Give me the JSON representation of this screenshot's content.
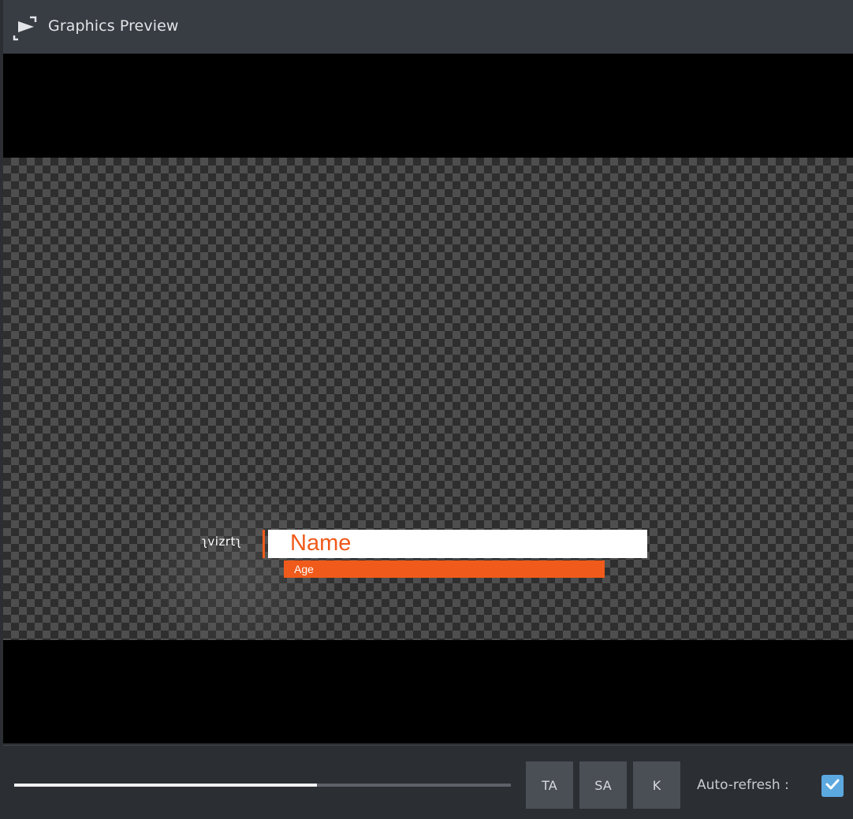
{
  "window": {
    "title": "Graphics Preview",
    "icon": "preview-window-icon"
  },
  "preview": {
    "logo_text": "ʅvizrtʅ",
    "lower_third": {
      "name": "Name",
      "age": "Age"
    },
    "colors": {
      "accent": "#f05a1a",
      "name_background": "#ffffff",
      "letterbox": "#000000"
    }
  },
  "controls": {
    "progress_fraction": 0.61,
    "buttons": [
      {
        "label": "TA"
      },
      {
        "label": "SA"
      },
      {
        "label": "K"
      }
    ],
    "auto_refresh": {
      "label": "Auto-refresh :",
      "checked": true,
      "check_icon": "checkmark-icon",
      "color": "#5ca9e0"
    }
  }
}
